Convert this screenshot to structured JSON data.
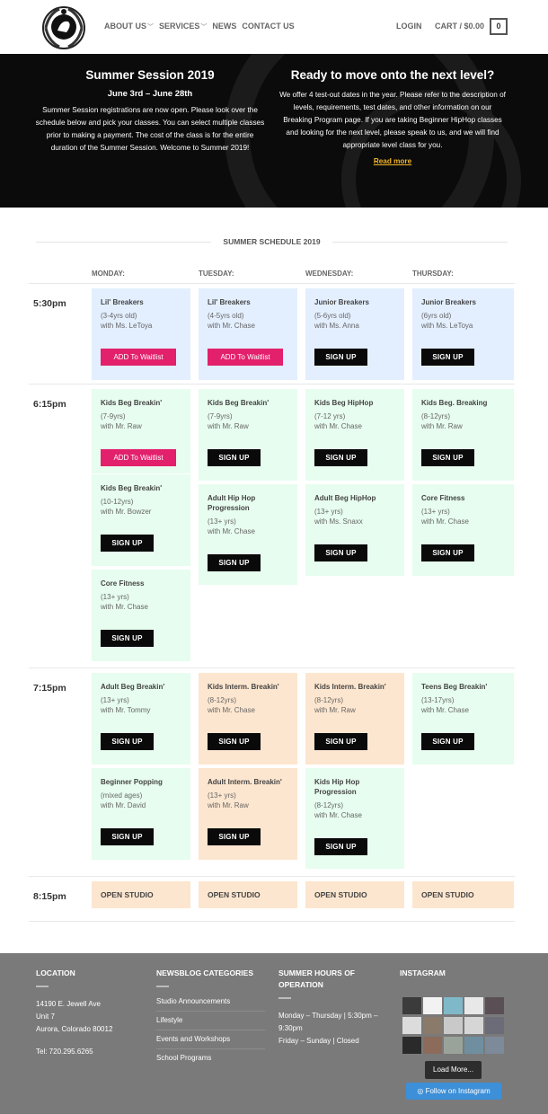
{
  "header": {
    "nav": [
      {
        "label": "ABOUT US",
        "caret": true
      },
      {
        "label": "SERVICES",
        "caret": true
      },
      {
        "label": "NEWS",
        "caret": false
      },
      {
        "label": "CONTACT US",
        "caret": false
      }
    ],
    "login": "LOGIN",
    "cart": "CART / $0.00",
    "cart_count": "0"
  },
  "hero": {
    "left_title": "Summer Session 2019",
    "left_dates": "June 3rd – June 28th",
    "left_text": "Summer Session registrations are now open. Please look over the schedule below and pick your classes. You can select multiple classes prior to making a payment. The cost of the class is for the entire duration of the Summer Session. Welcome to Summer 2019!",
    "right_title": "Ready to move onto the next level?",
    "right_text": "We offer 4 test-out dates in the year. Please refer to the description of levels, requirements, test dates, and other information on our Breaking Program page. If you are taking Beginner HipHop classes and looking for the next level, please speak to us, and we will find appropriate level class for you.",
    "read_more": "Read more"
  },
  "schedule": {
    "title": "SUMMER SCHEDULE 2019",
    "days": [
      "MONDAY:",
      "TUESDAY:",
      "WEDNESDAY:",
      "THURSDAY:"
    ],
    "times": [
      "5:30pm",
      "6:15pm",
      "7:15pm",
      "8:15pm"
    ],
    "signup_label": "SIGN UP",
    "waitlist_label": "ADD To Waitlist",
    "open_studio": "OPEN STUDIO",
    "classes": {
      "r1": [
        {
          "name": "Lil' Breakers",
          "age": "(3-4yrs old)",
          "teacher": "with Ms. LeToya",
          "action": "waitlist"
        },
        {
          "name": "Lil' Breakers",
          "age": "(4-5yrs old)",
          "teacher": "with Mr. Chase",
          "action": "waitlist"
        },
        {
          "name": "Junior Breakers",
          "age": "(5-6yrs old)",
          "teacher": "with Ms. Anna",
          "action": "signup"
        },
        {
          "name": "Junior Breakers",
          "age": "(6yrs old)",
          "teacher": "with Ms. LeToya",
          "action": "signup"
        }
      ],
      "r2": [
        {
          "name": "Kids Beg Breakin'",
          "age": "(7-9yrs)",
          "teacher": "with Mr. Raw",
          "action": "waitlist"
        },
        {
          "name": "Kids Beg Breakin'",
          "age": "(10-12yrs)",
          "teacher": "with Mr. Bowzer",
          "action": "signup"
        },
        {
          "name": "Core Fitness",
          "age": "(13+ yrs)",
          "teacher": "with Mr. Chase",
          "action": "signup"
        },
        {
          "name": "Kids Beg Breakin'",
          "age": "(7-9yrs)",
          "teacher": "with Mr. Raw",
          "action": "signup"
        },
        {
          "name": "Adult Hip Hop Progression",
          "age": "(13+ yrs)",
          "teacher": "with Mr. Chase",
          "action": "signup"
        },
        {
          "name": "Kids Beg HipHop",
          "age": "(7-12 yrs)",
          "teacher": "with Mr. Chase",
          "action": "signup"
        },
        {
          "name": "Adult Beg HipHop",
          "age": "(13+ yrs)",
          "teacher": "with Ms. Snaxx",
          "action": "signup"
        },
        {
          "name": "Kids Beg. Breaking",
          "age": "(8-12yrs)",
          "teacher": "with Mr. Raw",
          "action": "signup"
        },
        {
          "name": "Core Fitness",
          "age": "(13+ yrs)",
          "teacher": "with Mr. Chase",
          "action": "signup"
        }
      ],
      "r3": [
        {
          "name": "Adult Beg Breakin'",
          "age": "(13+ yrs)",
          "teacher": "with Mr. Tommy",
          "action": "signup"
        },
        {
          "name": "Beginner Popping",
          "age": "(mixed ages)",
          "teacher": "with Mr. David",
          "action": "signup"
        },
        {
          "name": "Kids Interm. Breakin'",
          "age": "(8-12yrs)",
          "teacher": "with Mr. Chase",
          "action": "signup"
        },
        {
          "name": "Adult Interm. Breakin'",
          "age": "(13+ yrs)",
          "teacher": "with Mr. Raw",
          "action": "signup"
        },
        {
          "name": "Kids Interm. Breakin'",
          "age": "(8-12yrs)",
          "teacher": "with Mr. Raw",
          "action": "signup"
        },
        {
          "name": "Kids Hip Hop Progression",
          "age": "(8-12yrs)",
          "teacher": "with Mr. Chase",
          "action": "signup"
        },
        {
          "name": "Teens Beg Breakin'",
          "age": "(13-17yrs)",
          "teacher": "with Mr. Chase",
          "action": "signup"
        }
      ]
    }
  },
  "footer": {
    "location_title": "LOCATION",
    "address1": "14190 E. Jewell Ave",
    "address2": "Unit 7",
    "address3": "Aurora, Colorado 80012",
    "tel": "Tel: 720.295.6265",
    "news_title": "NEWSBLOG CATEGORIES",
    "categories": [
      "Studio Announcements",
      "Lifestyle",
      "Events and Workshops",
      "School Programs"
    ],
    "hours_title": "SUMMER HOURS OF OPERATION",
    "hours1": "Monday – Thursday | 5:30pm – 9:30pm",
    "hours2": "Friday – Sunday | Closed",
    "instagram_title": "INSTAGRAM",
    "load_more": "Load More...",
    "follow": "Follow on Instagram"
  },
  "colors": {
    "blue_card": "#e3efff",
    "green_card": "#e7fdef",
    "peach_card": "#fde6cf",
    "waitlist_pink": "#e3206c",
    "signup_black": "#0a0a0a",
    "read_more_gold": "#f0b429",
    "footer_gray": "#7a7a7a",
    "instagram_blue": "#3d8fd8"
  }
}
